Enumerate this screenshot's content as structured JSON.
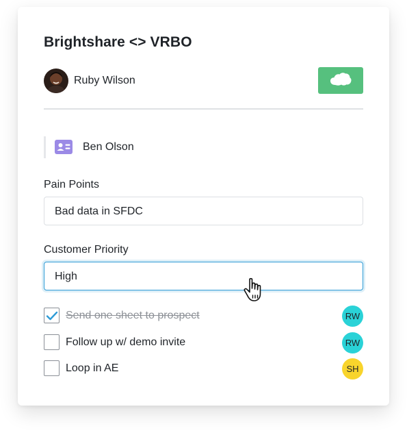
{
  "card": {
    "title": "Brightshare <> VRBO",
    "owner": {
      "name": "Ruby Wilson",
      "avatar_icon": "user-photo-avatar"
    },
    "salesforce_button": {
      "icon": "salesforce-cloud-icon",
      "color": "#56c07e"
    }
  },
  "contact": {
    "name": "Ben Olson",
    "icon": "contact-card-icon",
    "icon_color": "#9b8ae6"
  },
  "fields": {
    "pain_points": {
      "label": "Pain Points",
      "value": "Bad data in SFDC"
    },
    "customer_priority": {
      "label": "Customer Priority",
      "value": "High"
    }
  },
  "tasks": [
    {
      "text": "Send one sheet to prospect",
      "checked": true,
      "assignee": "RW",
      "assignee_color": "#2ad2d7"
    },
    {
      "text": "Follow up w/ demo invite",
      "checked": false,
      "assignee": "RW",
      "assignee_color": "#2ad2d7"
    },
    {
      "text": "Loop in AE",
      "checked": false,
      "assignee": "SH",
      "assignee_color": "#f8d42c"
    }
  ],
  "colors": {
    "focus_border": "#2e9bd6",
    "check_color": "#2e9bd6"
  }
}
